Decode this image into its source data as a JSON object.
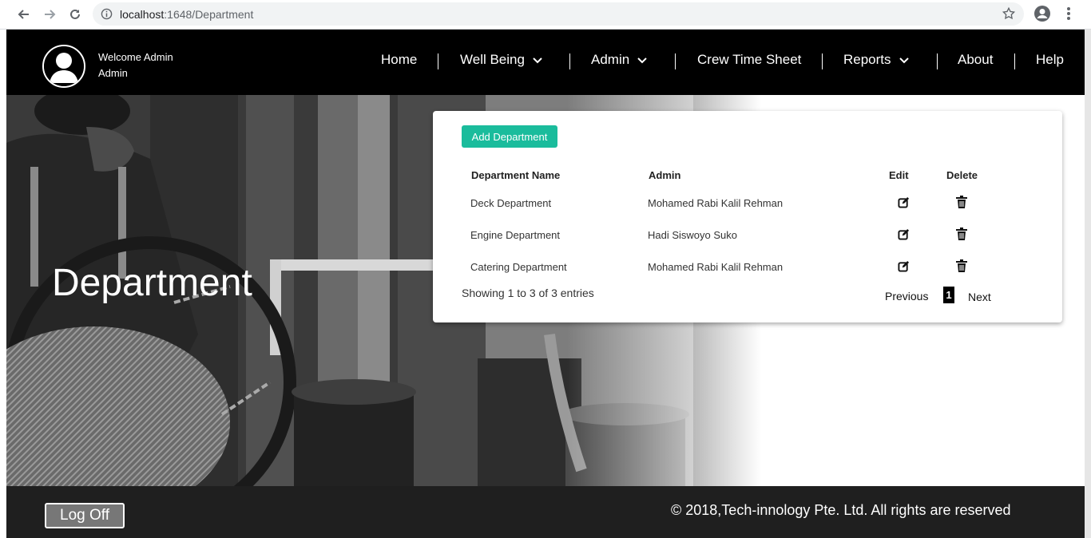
{
  "browser": {
    "url_host": "localhost",
    "url_path": ":1648/Department",
    "icons": [
      "back-arrow-icon",
      "forward-arrow-icon",
      "reload-icon",
      "info-icon",
      "star-icon",
      "profile-icon",
      "menu-dots-icon"
    ]
  },
  "header": {
    "welcome_line": "Welcome Admin",
    "role_line": "Admin",
    "nav": {
      "home": "Home",
      "well_being": "Well Being",
      "admin": "Admin",
      "crew_time_sheet": "Crew Time Sheet",
      "reports": "Reports",
      "about": "About",
      "help": "Help"
    }
  },
  "hero": {
    "title": "Department"
  },
  "card": {
    "add_button": "Add Department",
    "columns": {
      "name": "Department Name",
      "admin": "Admin",
      "edit": "Edit",
      "delete": "Delete"
    },
    "rows": [
      {
        "name": "Deck Department",
        "admin": "Mohamed Rabi Kalil Rehman"
      },
      {
        "name": "Engine Department",
        "admin": "Hadi Siswoyo Suko"
      },
      {
        "name": "Catering Department",
        "admin": "Mohamed Rabi Kalil Rehman"
      }
    ],
    "showing": "Showing 1 to 3 of 3 entries",
    "pager": {
      "previous": "Previous",
      "current": "1",
      "next": "Next"
    }
  },
  "footer": {
    "logoff": "Log Off",
    "copyright": "© 2018,Tech-innology Pte. Ltd. All rights are reserved"
  },
  "colors": {
    "accent": "#1abc9c",
    "header_bg": "#000000",
    "footer_bg": "#1f1f1f"
  }
}
